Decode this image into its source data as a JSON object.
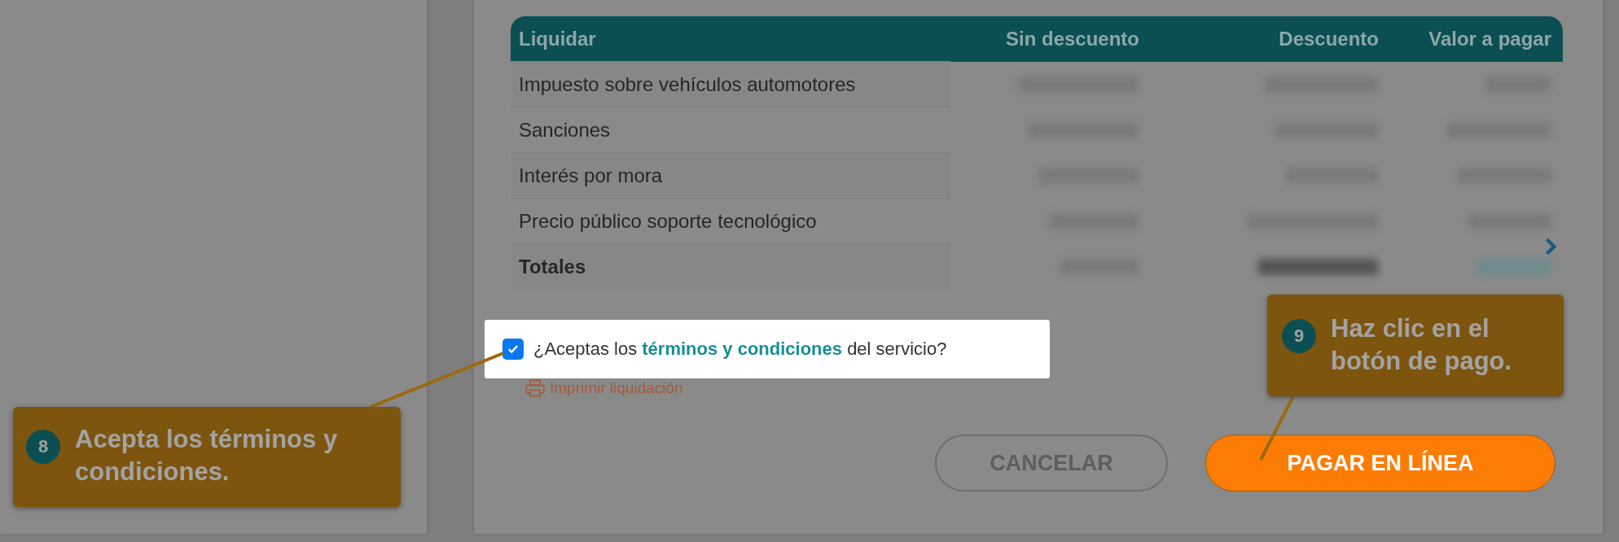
{
  "table": {
    "columns": [
      "Liquidar",
      "Sin descuento",
      "Descuento",
      "Valor a pagar"
    ],
    "rows": [
      {
        "label": "Impuesto sobre vehículos automotores",
        "kind": "item"
      },
      {
        "label": "Sanciones",
        "kind": "item"
      },
      {
        "label": "Interés por mora",
        "kind": "item"
      },
      {
        "label": "Precio público soporte tecnológico",
        "kind": "item"
      },
      {
        "label": "Totales",
        "kind": "total"
      }
    ]
  },
  "terms": {
    "checked": true,
    "prefix": "¿Aceptas los",
    "link": "términos y condiciones",
    "suffix": "del servicio?"
  },
  "print_link": "Imprimir liquidación",
  "buttons": [
    {
      "label": "CANCELAR",
      "kind": "secondary"
    },
    {
      "label": "PAGAR EN LÍNEA",
      "kind": "primary"
    }
  ],
  "callouts": [
    {
      "number": "8",
      "text": "Acepta los términos y condiciones."
    },
    {
      "number": "9",
      "text": "Haz clic en el botón de pago."
    }
  ]
}
